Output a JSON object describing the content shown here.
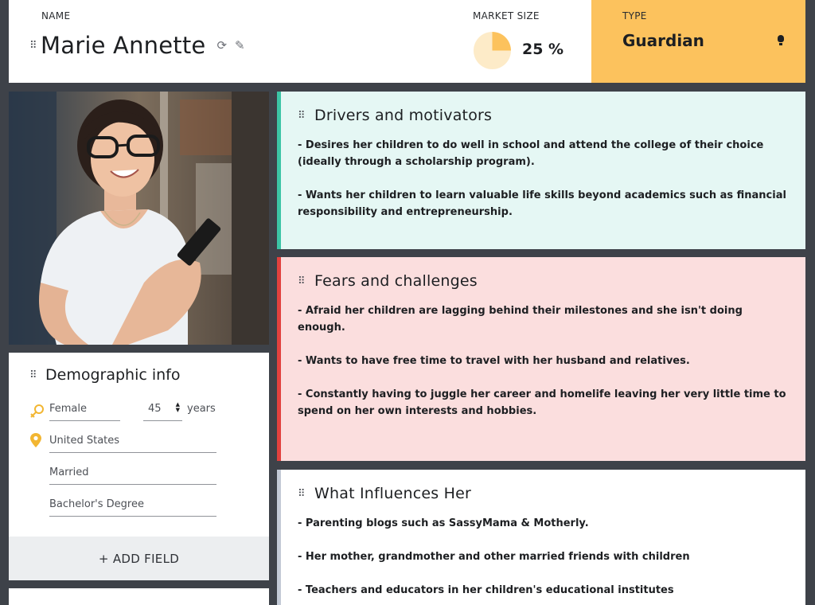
{
  "header": {
    "name_label": "NAME",
    "persona_name": "Marie Annette",
    "market_label": "MARKET SIZE",
    "market_value_text": "25 %",
    "market_share": 0.25,
    "type_label": "TYPE",
    "type_value": "Guardian"
  },
  "demographics": {
    "title": "Demographic info",
    "gender": "Female",
    "age": "45",
    "age_unit": "years",
    "country": "United States",
    "marital_status": "Married",
    "education": "Bachelor's Degree",
    "add_field_label": "+ ADD FIELD"
  },
  "cards": {
    "drivers": {
      "title": "Drivers and motivators",
      "items": [
        "- Desires her children to do well in school and attend the college of their choice (ideally through a scholarship program).",
        "- Wants her children to learn valuable life skills beyond academics such as financial responsibility and entrepreneurship."
      ]
    },
    "fears": {
      "title": "Fears and challenges",
      "items": [
        "- Afraid her children are lagging behind their milestones and she isn't doing enough.",
        "- Wants to have free time to travel with her husband and relatives.",
        "- Constantly having to juggle her career and homelife leaving her very little time to spend on her own interests and hobbies."
      ]
    },
    "influences": {
      "title": "What Influences Her",
      "items": [
        "- Parenting blogs such as SassyMama & Motherly.",
        "- Her mother, grandmother and other married friends with children",
        "- Teachers and educators in her children's educational institutes"
      ]
    }
  },
  "colors": {
    "type_bg": "#fcc25d",
    "pie_fill": "#fcc25d",
    "pie_bg": "#fdebc8",
    "drivers_bg": "#e5f7f4",
    "drivers_accent": "#3cc5a6",
    "fears_bg": "#fbdede",
    "fears_accent": "#e2413e",
    "influences_accent": "#c3cad6",
    "icon_gold": "#f2b632"
  },
  "icons": {
    "drag": "drag-handle-icon",
    "refresh": "refresh-icon",
    "edit": "pencil-icon",
    "type": "lightbulb-icon",
    "gender": "female-symbol-icon",
    "location": "map-pin-icon"
  }
}
